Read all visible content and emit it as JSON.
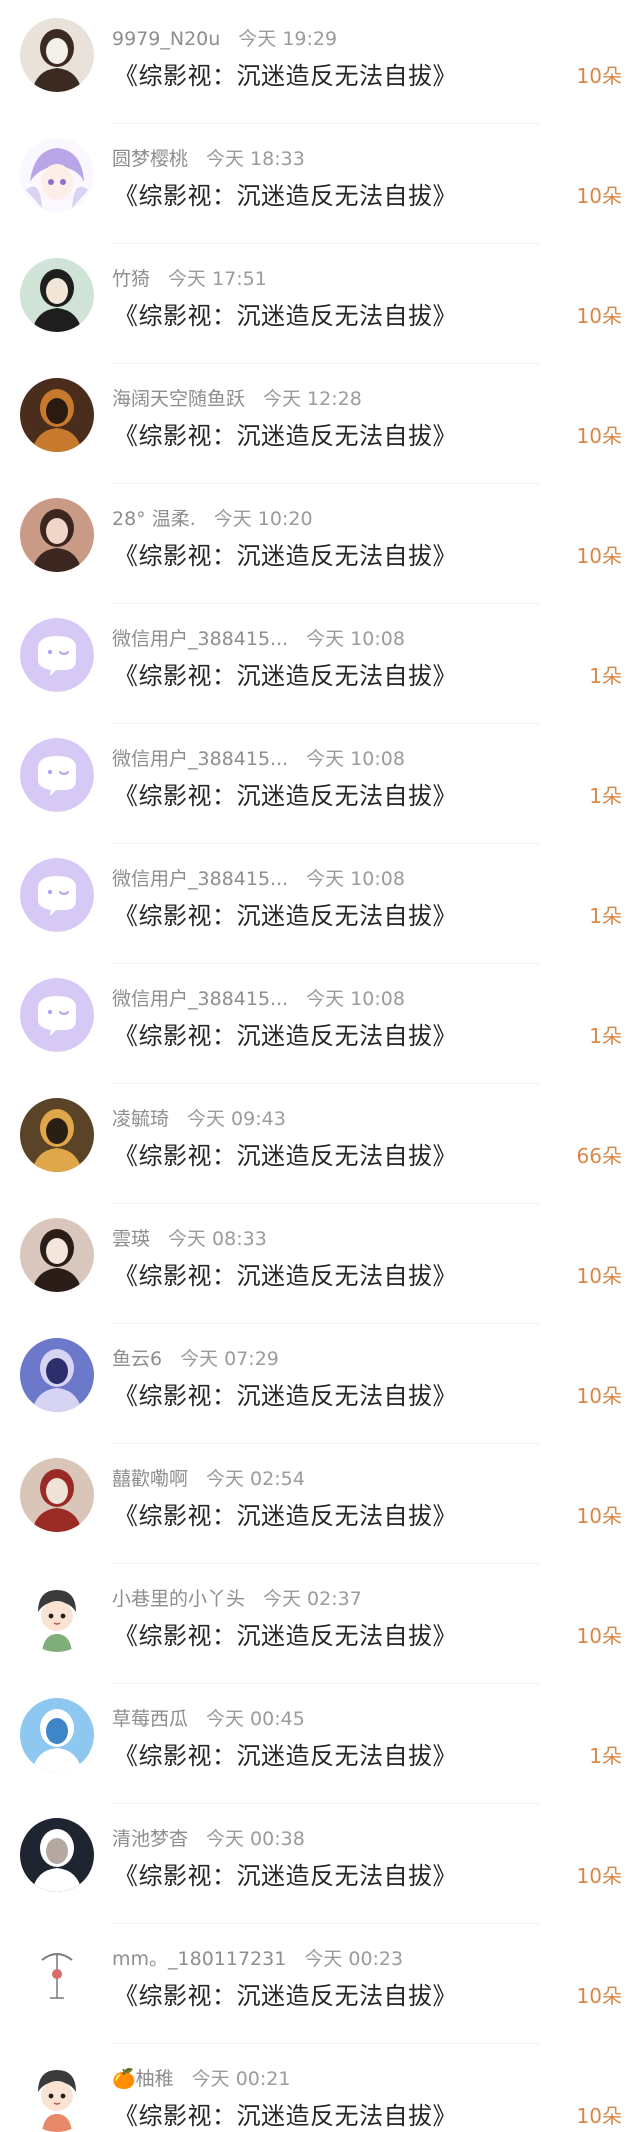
{
  "rows": [
    {
      "user": "9979_N20u",
      "time": "今天 19:29",
      "title": "《综影视：沉迷造反无法自拔》",
      "gift": "10朵",
      "avatar": "photo-avatar",
      "colors": [
        "#e8e2da",
        "#3a2a22",
        "#f3efe9"
      ]
    },
    {
      "user": "圆梦樱桃",
      "time": "今天 18:33",
      "title": "《综影视：沉迷造反无法自拔》",
      "gift": "10朵",
      "avatar": "anime-avatar",
      "colors": [
        "#d9d2f0",
        "#b9a6e6",
        "#fbf7ff"
      ]
    },
    {
      "user": "竹猗",
      "time": "今天 17:51",
      "title": "《综影视：沉迷造反无法自拔》",
      "gift": "10朵",
      "avatar": "photo-avatar",
      "colors": [
        "#cfe3d6",
        "#1e1e1e",
        "#f1e6d8"
      ]
    },
    {
      "user": "海阔天空随鱼跃",
      "time": "今天 12:28",
      "title": "《综影视：沉迷造反无法自拔》",
      "gift": "10朵",
      "avatar": "photo-avatar",
      "colors": [
        "#4a2d1c",
        "#c77a2d",
        "#2b1a12"
      ]
    },
    {
      "user": "28° 温柔.",
      "time": "今天 10:20",
      "title": "《综影视：沉迷造反无法自拔》",
      "gift": "10朵",
      "avatar": "photo-avatar",
      "colors": [
        "#c99b86",
        "#3b2620",
        "#f0d6c8"
      ]
    },
    {
      "user": "微信用户_388415...",
      "time": "今天 10:08",
      "title": "《综影视：沉迷造反无法自拔》",
      "gift": "1朵",
      "avatar": "default-wechat-avatar",
      "colors": [
        "#d7c9f5",
        "#ffffff",
        "#b7a3ea"
      ]
    },
    {
      "user": "微信用户_388415...",
      "time": "今天 10:08",
      "title": "《综影视：沉迷造反无法自拔》",
      "gift": "1朵",
      "avatar": "default-wechat-avatar",
      "colors": [
        "#d7c9f5",
        "#ffffff",
        "#b7a3ea"
      ]
    },
    {
      "user": "微信用户_388415...",
      "time": "今天 10:08",
      "title": "《综影视：沉迷造反无法自拔》",
      "gift": "1朵",
      "avatar": "default-wechat-avatar",
      "colors": [
        "#d7c9f5",
        "#ffffff",
        "#b7a3ea"
      ]
    },
    {
      "user": "微信用户_388415...",
      "time": "今天 10:08",
      "title": "《综影视：沉迷造反无法自拔》",
      "gift": "1朵",
      "avatar": "default-wechat-avatar",
      "colors": [
        "#d7c9f5",
        "#ffffff",
        "#b7a3ea"
      ]
    },
    {
      "user": "凌毓琦",
      "time": "今天 09:43",
      "title": "《综影视：沉迷造反无法自拔》",
      "gift": "66朵",
      "avatar": "photo-avatar",
      "colors": [
        "#5a4326",
        "#e0a64a",
        "#2a1f14"
      ]
    },
    {
      "user": "雲瑛",
      "time": "今天 08:33",
      "title": "《综影视：沉迷造反无法自拔》",
      "gift": "10朵",
      "avatar": "photo-avatar",
      "colors": [
        "#d9c7bd",
        "#2b1d18",
        "#f4e6dd"
      ]
    },
    {
      "user": "鱼云6",
      "time": "今天 07:29",
      "title": "《综影视：沉迷造反无法自拔》",
      "gift": "10朵",
      "avatar": "photo-avatar",
      "colors": [
        "#6c78c9",
        "#d7d3f2",
        "#2c2f6b"
      ]
    },
    {
      "user": "囍歡嘞啊",
      "time": "今天 02:54",
      "title": "《综影视：沉迷造反无法自拔》",
      "gift": "10朵",
      "avatar": "photo-avatar",
      "colors": [
        "#d9c6b8",
        "#9a2a25",
        "#efe2d6"
      ]
    },
    {
      "user": "小巷里的小丫头",
      "time": "今天 02:37",
      "title": "《综影视：沉迷造反无法自拔》",
      "gift": "10朵",
      "avatar": "cartoon-avatar",
      "colors": [
        "#ffffff",
        "#3a3a3a",
        "#7fae7a"
      ]
    },
    {
      "user": "草莓西瓜",
      "time": "今天 00:45",
      "title": "《综影视：沉迷造反无法自拔》",
      "gift": "1朵",
      "avatar": "photo-avatar",
      "colors": [
        "#8ec7ef",
        "#ffffff",
        "#3f86c9"
      ]
    },
    {
      "user": "清池梦杳",
      "time": "今天 00:38",
      "title": "《综影视：沉迷造反无法自拔》",
      "gift": "10朵",
      "avatar": "photo-avatar",
      "colors": [
        "#1f2431",
        "#ffffff",
        "#b5a8a0"
      ]
    },
    {
      "user": "mm。_180117231",
      "time": "今天 00:23",
      "title": "《综影视：沉迷造反无法自拔》",
      "gift": "10朵",
      "avatar": "sketch-avatar",
      "colors": [
        "#ffffff",
        "#7a7a7a",
        "#d96b6b"
      ]
    },
    {
      "user": "🍊柚稚",
      "time": "今天 00:21",
      "title": "《综影视：沉迷造反无法自拔》",
      "gift": "10朵",
      "avatar": "cartoon-avatar",
      "colors": [
        "#ffffff",
        "#3a3a3a",
        "#e88a6a"
      ]
    }
  ]
}
